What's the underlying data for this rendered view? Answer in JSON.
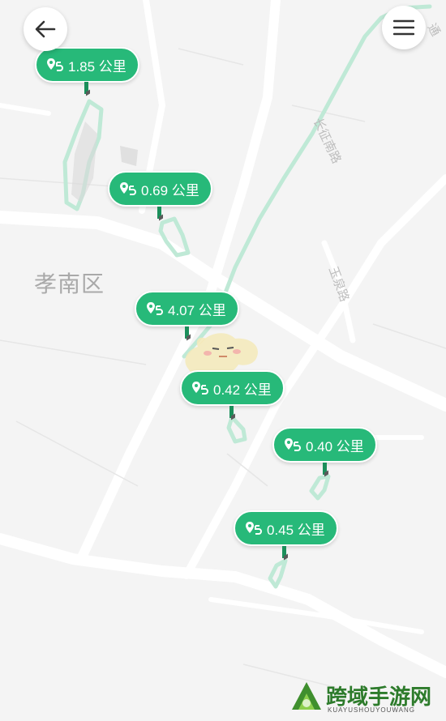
{
  "map": {
    "district_label": "孝南区",
    "road_labels": [
      "长征南路",
      "玉泉路",
      "通"
    ],
    "colors": {
      "background": "#f4f4f4",
      "road": "#ffffff",
      "route": "#bfe9d6",
      "marker": "#27b979"
    }
  },
  "controls": {
    "back_icon": "arrow-left-icon",
    "menu_icon": "hamburger-menu-icon"
  },
  "markers": [
    {
      "distance": "1.85 公里"
    },
    {
      "distance": "0.69 公里"
    },
    {
      "distance": "4.07 公里"
    },
    {
      "distance": "0.42 公里"
    },
    {
      "distance": "0.40 公里"
    },
    {
      "distance": "0.45 公里"
    }
  ],
  "watermark": {
    "text": "跨域手游网",
    "sub": "KUAYUSHOUYOUWANG"
  }
}
